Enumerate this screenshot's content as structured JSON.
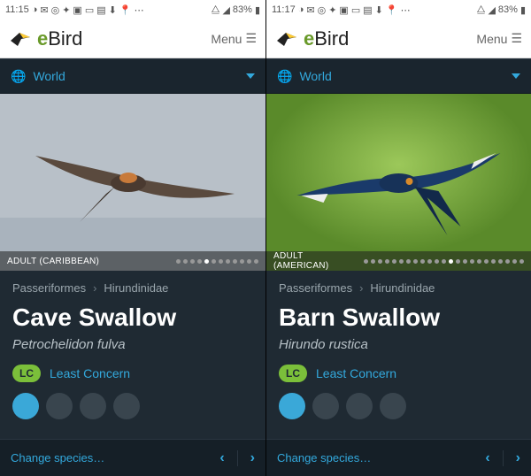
{
  "screens": [
    {
      "statusbar": {
        "time": "11:15",
        "battery": "83%"
      },
      "header": {
        "logo_e": "e",
        "logo_rest": "Bird",
        "menu": "Menu"
      },
      "world": {
        "label": "World"
      },
      "photo": {
        "label": "ADULT (CARIBBEAN)",
        "dot_count": 12,
        "active_dot": 4,
        "bg": "sky"
      },
      "crumbs": {
        "order": "Passeriformes",
        "family": "Hirundinidae"
      },
      "species": {
        "common": "Cave Swallow",
        "scientific": "Petrochelidon fulva"
      },
      "status": {
        "code": "LC",
        "text": "Least Concern"
      },
      "bottom": {
        "change": "Change species…"
      }
    },
    {
      "statusbar": {
        "time": "11:17",
        "battery": "83%"
      },
      "header": {
        "logo_e": "e",
        "logo_rest": "Bird",
        "menu": "Menu"
      },
      "world": {
        "label": "World"
      },
      "photo": {
        "label": "ADULT (AMERICAN)",
        "dot_count": 23,
        "active_dot": 12,
        "bg": "green"
      },
      "crumbs": {
        "order": "Passeriformes",
        "family": "Hirundinidae"
      },
      "species": {
        "common": "Barn Swallow",
        "scientific": "Hirundo rustica"
      },
      "status": {
        "code": "LC",
        "text": "Least Concern"
      },
      "bottom": {
        "change": "Change species…"
      }
    }
  ]
}
